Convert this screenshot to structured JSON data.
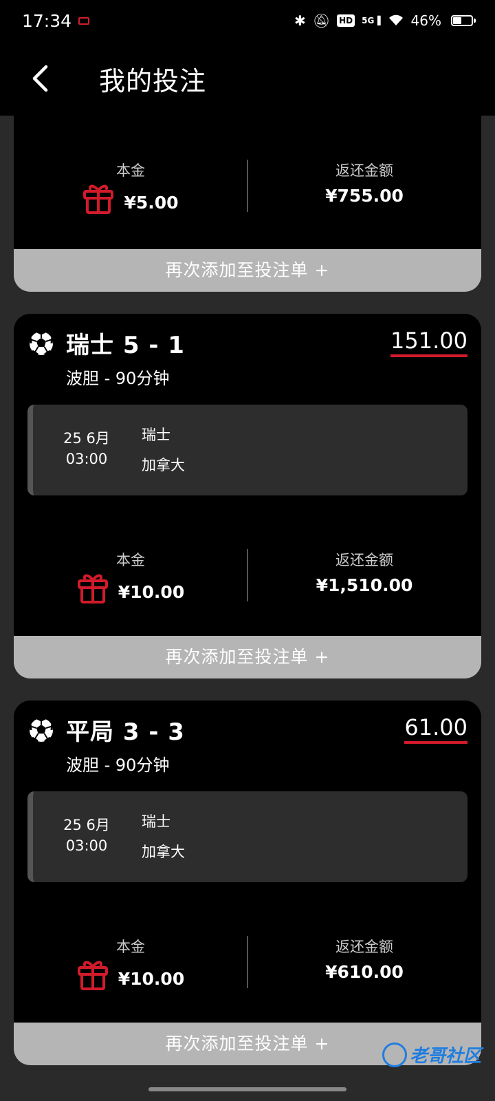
{
  "status_bar": {
    "time": "17:34",
    "network": "5G",
    "hd": "HD",
    "battery_text": "46%",
    "battery_level": 0.46
  },
  "header": {
    "title": "我的投注"
  },
  "labels": {
    "stake": "本金",
    "return": "返还金额",
    "re_add": "再次添加至投注单 +"
  },
  "bets": [
    {
      "stake": "¥5.00",
      "return": "¥755.00"
    },
    {
      "selection": "瑞士 5 - 1",
      "odds": "151.00",
      "market": "波胆 - 90分钟",
      "date": "25 6月",
      "time": "03:00",
      "home": "瑞士",
      "away": "加拿大",
      "stake": "¥10.00",
      "return": "¥1,510.00"
    },
    {
      "selection": "平局 3 - 3",
      "odds": "61.00",
      "market": "波胆 - 90分钟",
      "date": "25 6月",
      "time": "03:00",
      "home": "瑞士",
      "away": "加拿大",
      "stake": "¥10.00",
      "return": "¥610.00"
    }
  ],
  "watermark": "老哥社区",
  "colors": {
    "accent_red": "#d21b2a",
    "card_bg": "#000000",
    "page_bg": "#2a2a2a",
    "button_bg": "#b5b5b5"
  }
}
